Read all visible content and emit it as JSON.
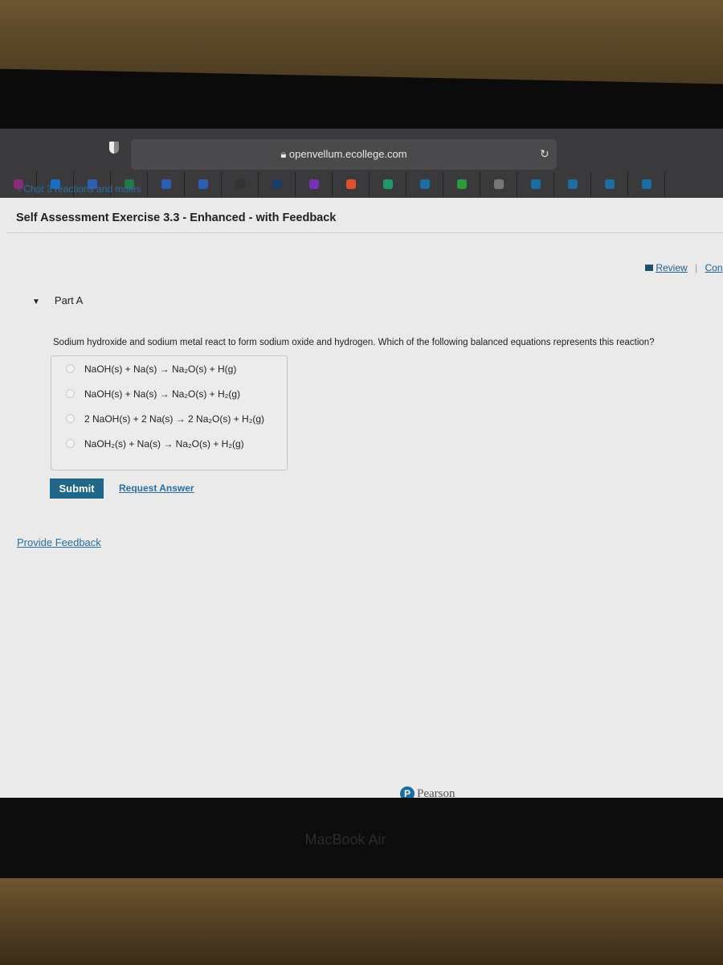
{
  "browser": {
    "url": "openvellum.ecollege.com",
    "bookmarks": [
      {
        "icon": "infinity-icon",
        "color": "#8a2a7a"
      },
      {
        "icon": "outlook-icon",
        "color": "#1a6fc4"
      },
      {
        "icon": "word-icon",
        "color": "#2b5fb4"
      },
      {
        "icon": "excel-icon",
        "color": "#1e7b45"
      },
      {
        "icon": "word-icon",
        "color": "#2b5fb4"
      },
      {
        "icon": "word-icon",
        "color": "#2b5fb4"
      },
      {
        "icon": "lu-icon",
        "color": "#333333"
      },
      {
        "icon": "feather-icon",
        "color": "#1b3b6b"
      },
      {
        "icon": "w-icon",
        "color": "#7a2fb8"
      },
      {
        "icon": "bookmark-red-icon",
        "color": "#e0502a"
      },
      {
        "icon": "shield-green-icon",
        "color": "#1e9a6a"
      },
      {
        "icon": "pearson-icon",
        "color": "#1a6ea3"
      },
      {
        "icon": "plus-green-icon",
        "color": "#2a9a3a"
      },
      {
        "icon": "grey-box-icon",
        "color": "#777777"
      },
      {
        "icon": "pearson-icon",
        "color": "#1a6ea3"
      },
      {
        "icon": "pearson-icon",
        "color": "#1a6ea3"
      },
      {
        "icon": "pearson-icon",
        "color": "#1a6ea3"
      },
      {
        "icon": "pearson-icon",
        "color": "#1a6ea3"
      }
    ]
  },
  "page": {
    "breadcrumb": "‹ Chpt 3 reactions and moles",
    "title": "Self Assessment Exercise 3.3 - Enhanced - with Feedback",
    "review": "Review",
    "separator": "|",
    "continue": "Con",
    "part": "Part A",
    "question": "Sodium hydroxide and sodium metal react to form sodium oxide and hydrogen. Which of the following balanced equations represents this reaction?",
    "options": [
      "NaOH(s) + Na(s) → Na₂O(s) + H(g)",
      "NaOH(s) + Na(s) → Na₂O(s) + H₂(g)",
      "2 NaOH(s) + 2 Na(s) → 2 Na₂O(s) + H₂(g)",
      "NaOH₂(s) + Na(s) → Na₂O(s) + H₂(g)"
    ],
    "submit": "Submit",
    "request_answer": "Request Answer",
    "provide_feedback": "Provide Feedback",
    "footer_logo": "Pearson",
    "accent": "#1f6689"
  },
  "device": {
    "label": "MacBook Air"
  }
}
